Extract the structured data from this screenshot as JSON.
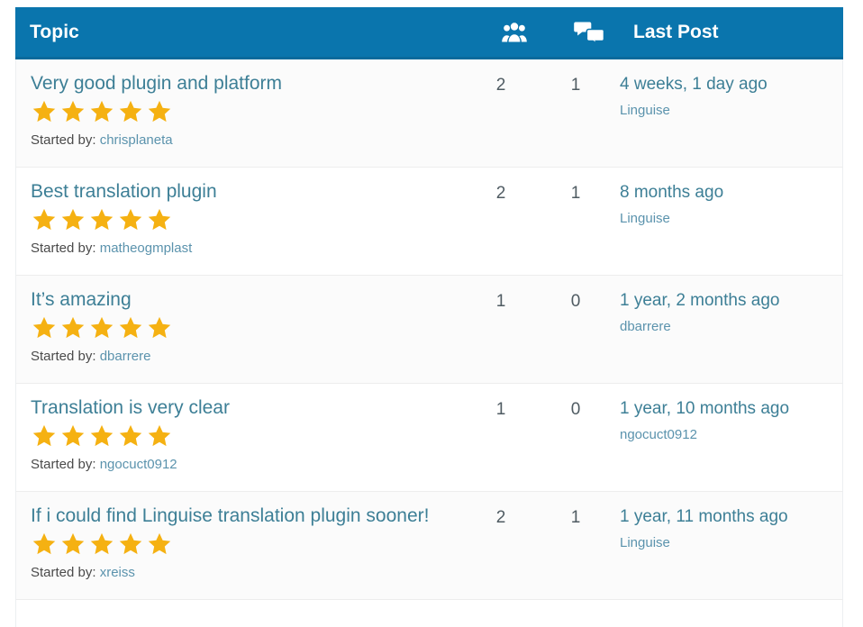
{
  "theme": {
    "header_bg": "#0a75ad",
    "header_rule": "#0a6a9c",
    "link_color": "#3d7f96",
    "muted_link_color": "#5b93ad",
    "star_color": "#f5b112",
    "row_bg": "#fbfbfb",
    "row_alt_bg": "#ffffff"
  },
  "header": {
    "topic_label": "Topic",
    "voices_icon": "users-icon",
    "posts_icon": "speech-bubbles-icon",
    "last_post_label": "Last Post"
  },
  "rows": [
    {
      "title": "Very good plugin and platform",
      "rating": 5,
      "started_by_label": "Started by:",
      "started_by_user": "chrisplaneta",
      "voices": "2",
      "posts": "1",
      "last_post_time": "4 weeks, 1 day ago",
      "last_post_author": "Linguise"
    },
    {
      "title": "Best translation plugin",
      "rating": 5,
      "started_by_label": "Started by:",
      "started_by_user": "matheogmplast",
      "voices": "2",
      "posts": "1",
      "last_post_time": "8 months ago",
      "last_post_author": "Linguise"
    },
    {
      "title": "It’s amazing",
      "rating": 5,
      "started_by_label": "Started by:",
      "started_by_user": "dbarrere",
      "voices": "1",
      "posts": "0",
      "last_post_time": "1 year, 2 months ago",
      "last_post_author": "dbarrere"
    },
    {
      "title": "Translation is very clear",
      "rating": 5,
      "started_by_label": "Started by:",
      "started_by_user": "ngocuct0912",
      "voices": "1",
      "posts": "0",
      "last_post_time": "1 year, 10 months ago",
      "last_post_author": "ngocuct0912"
    },
    {
      "title": "If i could find Linguise translation plugin sooner!",
      "rating": 5,
      "started_by_label": "Started by:",
      "started_by_user": "xreiss",
      "voices": "2",
      "posts": "1",
      "last_post_time": "1 year, 11 months ago",
      "last_post_author": "Linguise"
    }
  ]
}
